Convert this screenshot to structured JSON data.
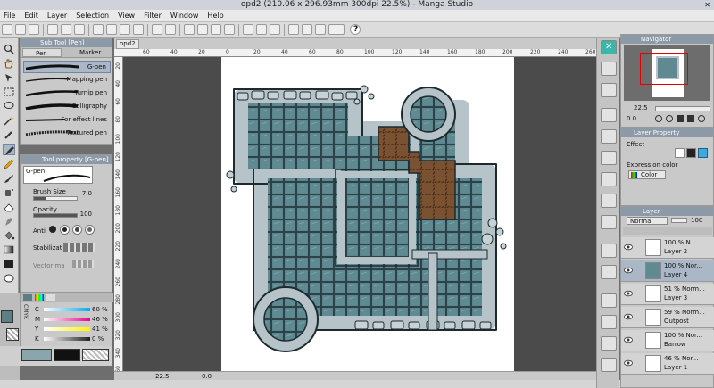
{
  "window": {
    "title": "opd2 (210.06 x 296.93mm 300dpi 22.5%)  - Manga Studio"
  },
  "menu": [
    "File",
    "Edit",
    "Layer",
    "Selection",
    "View",
    "Filter",
    "Window",
    "Help"
  ],
  "sub_tool": {
    "title": "Sub Tool [Pen]",
    "tabs": [
      "Pen",
      "Marker"
    ],
    "brushes": [
      "G-pen",
      "Mapping pen",
      "Turnip pen",
      "Calligraphy",
      "For effect lines",
      "Textured pen"
    ]
  },
  "tool_property": {
    "title": "Tool property [G-pen]",
    "preview_label": "G-pen",
    "brush_size_label": "Brush Size",
    "brush_size_value": "7.0",
    "opacity_label": "Opacity",
    "opacity_value": "100",
    "opacity_level": 1.0,
    "brush_size_level": 0.3,
    "anti_alias_label": "Anti",
    "stabilization_label": "Stabilizat",
    "vector_label": "Vector ma"
  },
  "color_panel": {
    "tabs": [
      "CMYK"
    ],
    "channels": [
      {
        "name": "C",
        "value": "60 %",
        "color": "#00aeef"
      },
      {
        "name": "M",
        "value": "46 %",
        "color": "#ec008c"
      },
      {
        "name": "Y",
        "value": "41 %",
        "color": "#fff200"
      },
      {
        "name": "K",
        "value": "0 %",
        "color": "#222222"
      }
    ],
    "main_color": "#5c7f86"
  },
  "document": {
    "tab_label": "opd2",
    "h_ruler_ticks": [
      "60",
      "40",
      "20",
      "0",
      "20",
      "40",
      "60",
      "80",
      "100",
      "120",
      "140",
      "160",
      "180",
      "200",
      "220",
      "240",
      "260"
    ],
    "v_ruler_ticks": [
      "20",
      "40",
      "60",
      "80",
      "100",
      "120",
      "140",
      "160",
      "180",
      "200",
      "220",
      "240",
      "260",
      "280",
      "300",
      "320",
      "340",
      "360"
    ]
  },
  "status": {
    "zoom": "22.5",
    "rotation": "0.0"
  },
  "navigator": {
    "title": "Navigator",
    "zoom": "22.5",
    "rotation": "0.0"
  },
  "layer_property": {
    "title": "Layer Property",
    "effect_label": "Effect",
    "expression_color_label": "Expression color",
    "expression_color_value": "Color"
  },
  "layers_panel": {
    "title": "Layer",
    "blend_mode": "Normal",
    "opacity": "100",
    "layers": [
      {
        "opacity": "100 %",
        "mode": "N",
        "name": "Layer 2"
      },
      {
        "opacity": "100 %",
        "mode": "Nor...",
        "name": "Layer 4",
        "selected": true
      },
      {
        "opacity": "51 %",
        "mode": "Norm...",
        "name": "Layer 3"
      },
      {
        "opacity": "59 %",
        "mode": "Norm...",
        "name": "Outpost"
      },
      {
        "opacity": "100 %",
        "mode": "Nor...",
        "name": "Barrow"
      },
      {
        "opacity": "46 %",
        "mode": "Nor...",
        "name": "Layer 1"
      }
    ]
  }
}
